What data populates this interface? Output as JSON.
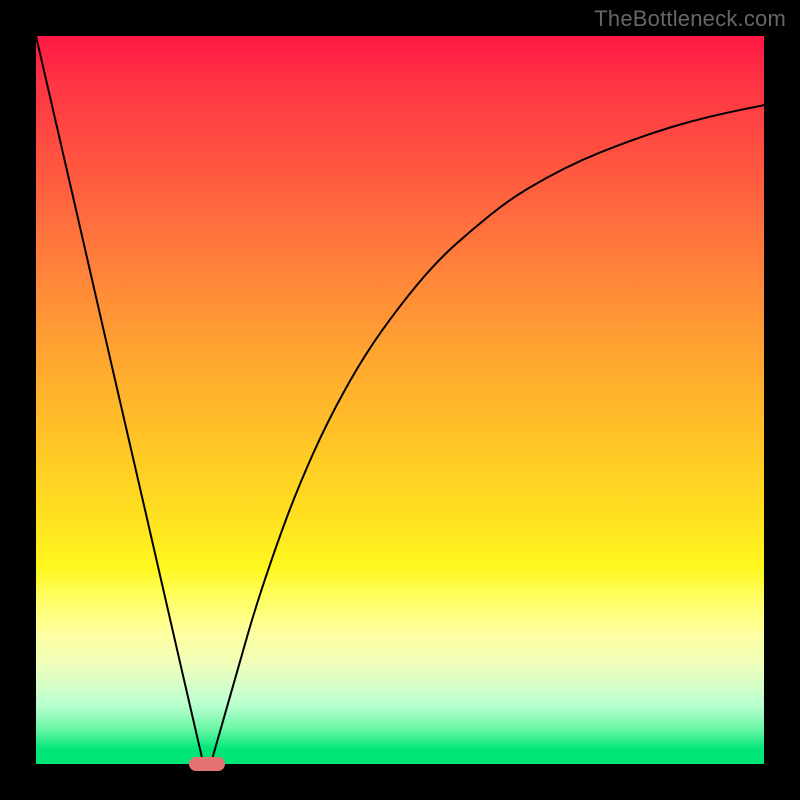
{
  "watermark": {
    "text": "TheBottleneck.com"
  },
  "chart_data": {
    "type": "line",
    "title": "",
    "xlabel": "",
    "ylabel": "",
    "xlim": [
      0,
      100
    ],
    "ylim": [
      0,
      100
    ],
    "grid": false,
    "background_gradient": {
      "direction": "vertical",
      "stops": [
        {
          "pos": 0.0,
          "color": "#ff1744"
        },
        {
          "pos": 0.5,
          "color": "#ffc028"
        },
        {
          "pos": 0.77,
          "color": "#ffff60"
        },
        {
          "pos": 0.98,
          "color": "#00e676"
        }
      ]
    },
    "series": [
      {
        "name": "left-descent",
        "x": [
          0,
          5,
          10,
          15,
          20,
          23
        ],
        "y": [
          100,
          78.3,
          56.5,
          34.8,
          13.0,
          0
        ],
        "stroke": "#000000",
        "stroke_width": 2
      },
      {
        "name": "right-curve",
        "x": [
          24,
          26,
          28,
          30,
          33,
          36,
          40,
          45,
          50,
          55,
          60,
          65,
          70,
          75,
          80,
          85,
          90,
          95,
          100
        ],
        "y": [
          0,
          7,
          14,
          21,
          30,
          38,
          47,
          56,
          63,
          69,
          73.5,
          77.5,
          80.5,
          83,
          85,
          86.8,
          88.3,
          89.5,
          90.5
        ],
        "stroke": "#000000",
        "stroke_width": 2
      }
    ],
    "marker": {
      "name": "min-marker",
      "x": 23.5,
      "y": 0,
      "color": "#e57373",
      "shape": "pill"
    }
  }
}
